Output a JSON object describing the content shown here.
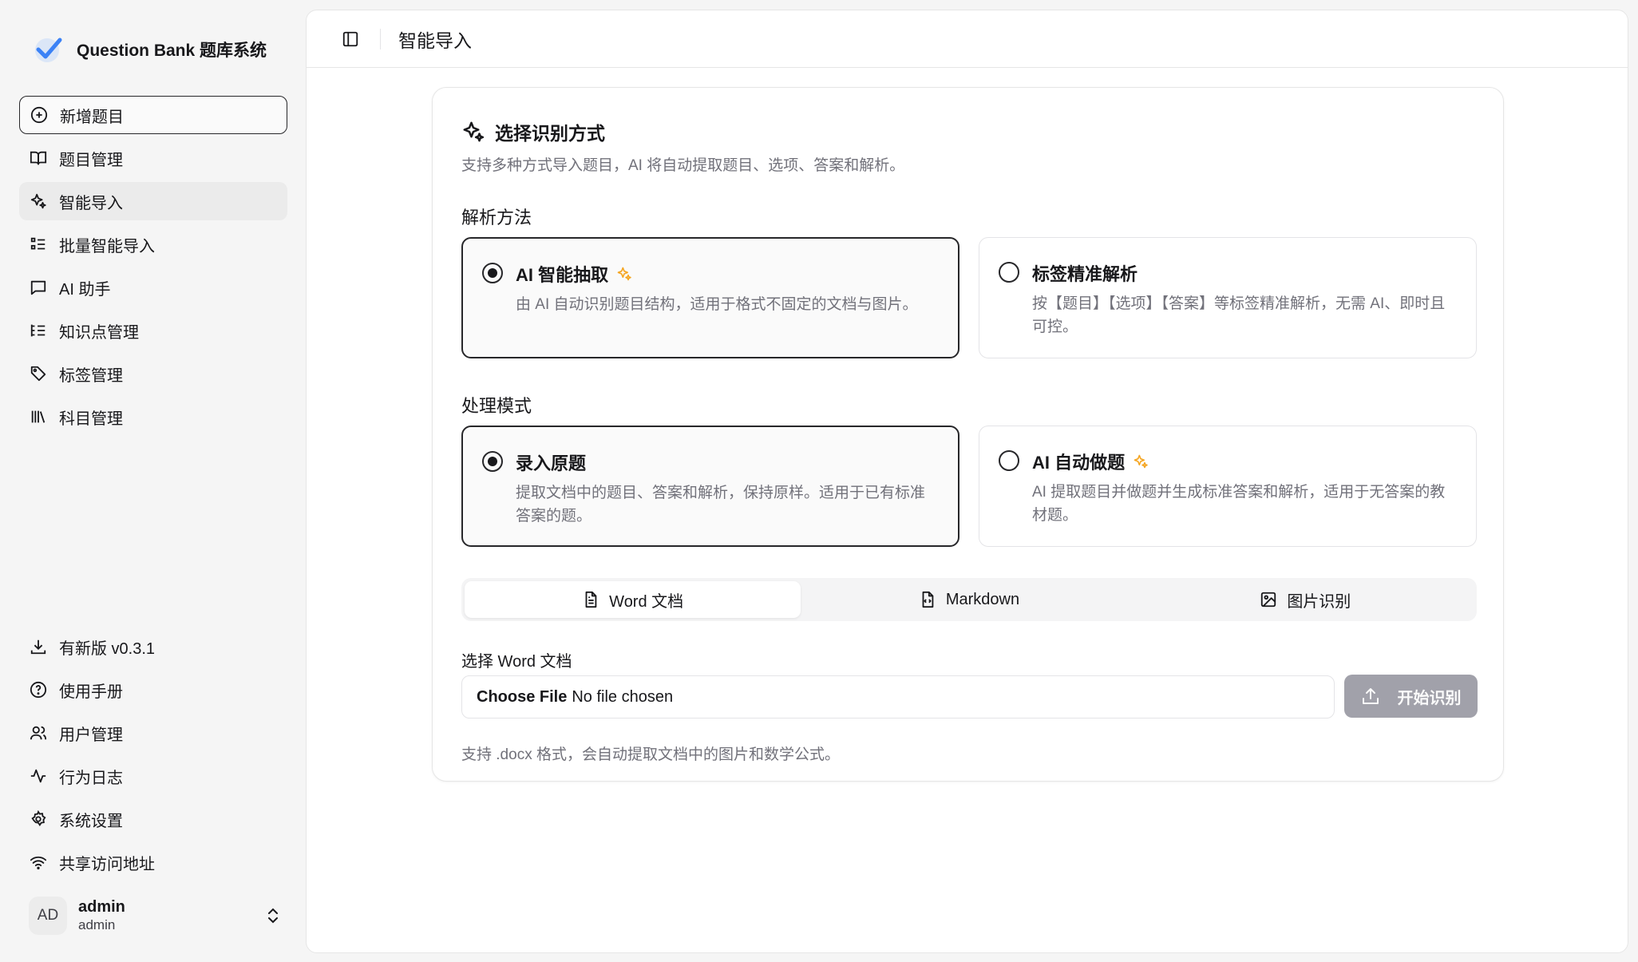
{
  "brand": {
    "name": "Question Bank 题库系统"
  },
  "nav": {
    "items": [
      {
        "label": "新增题目",
        "icon": "plus-circle-icon"
      },
      {
        "label": "题目管理",
        "icon": "book-open-icon"
      },
      {
        "label": "智能导入",
        "icon": "sparkles-icon"
      },
      {
        "label": "批量智能导入",
        "icon": "list-checks-icon"
      },
      {
        "label": "AI 助手",
        "icon": "message-square-icon"
      },
      {
        "label": "知识点管理",
        "icon": "list-tree-icon"
      },
      {
        "label": "标签管理",
        "icon": "tag-icon"
      },
      {
        "label": "科目管理",
        "icon": "library-icon"
      }
    ],
    "bottom": [
      {
        "label": "有新版 v0.3.1",
        "icon": "download-icon"
      },
      {
        "label": "使用手册",
        "icon": "help-circle-icon"
      },
      {
        "label": "用户管理",
        "icon": "users-icon"
      },
      {
        "label": "行为日志",
        "icon": "activity-icon"
      },
      {
        "label": "系统设置",
        "icon": "settings-icon"
      },
      {
        "label": "共享访问地址",
        "icon": "wifi-icon"
      }
    ]
  },
  "user": {
    "initials": "AD",
    "name": "admin",
    "role": "admin"
  },
  "header": {
    "title": "智能导入"
  },
  "card": {
    "title": "选择识别方式",
    "description": "支持多种方式导入题目，AI 将自动提取题目、选项、答案和解析。",
    "parse_method": {
      "label": "解析方法",
      "options": [
        {
          "title": "AI 智能抽取",
          "desc": "由 AI 自动识别题目结构，适用于格式不固定的文档与图片。",
          "selected": true
        },
        {
          "title": "标签精准解析",
          "desc": "按【题目】【选项】【答案】等标签精准解析，无需 AI、即时且可控。",
          "selected": false
        }
      ]
    },
    "process_mode": {
      "label": "处理模式",
      "options": [
        {
          "title": "录入原题",
          "desc": "提取文档中的题目、答案和解析，保持原样。适用于已有标准答案的题。",
          "selected": true
        },
        {
          "title": "AI 自动做题",
          "desc": "AI 提取题目并做题并生成标准答案和解析，适用于无答案的教材题。",
          "selected": false
        }
      ]
    },
    "tabs": [
      {
        "label": "Word 文档",
        "icon": "file-text-icon",
        "active": true
      },
      {
        "label": "Markdown",
        "icon": "file-code-icon",
        "active": false
      },
      {
        "label": "图片识别",
        "icon": "image-icon",
        "active": false
      }
    ],
    "file": {
      "label": "选择 Word 文档",
      "button": "Choose File",
      "status": "No file chosen",
      "hint": "支持 .docx 格式，会自动提取文档中的图片和数学公式。"
    },
    "start_button": "开始识别"
  },
  "colors": {
    "primary": "#18181b",
    "accent_sparkle": "#f5a623",
    "muted": "#71717a",
    "disabled_button": "#a1a1aa"
  }
}
